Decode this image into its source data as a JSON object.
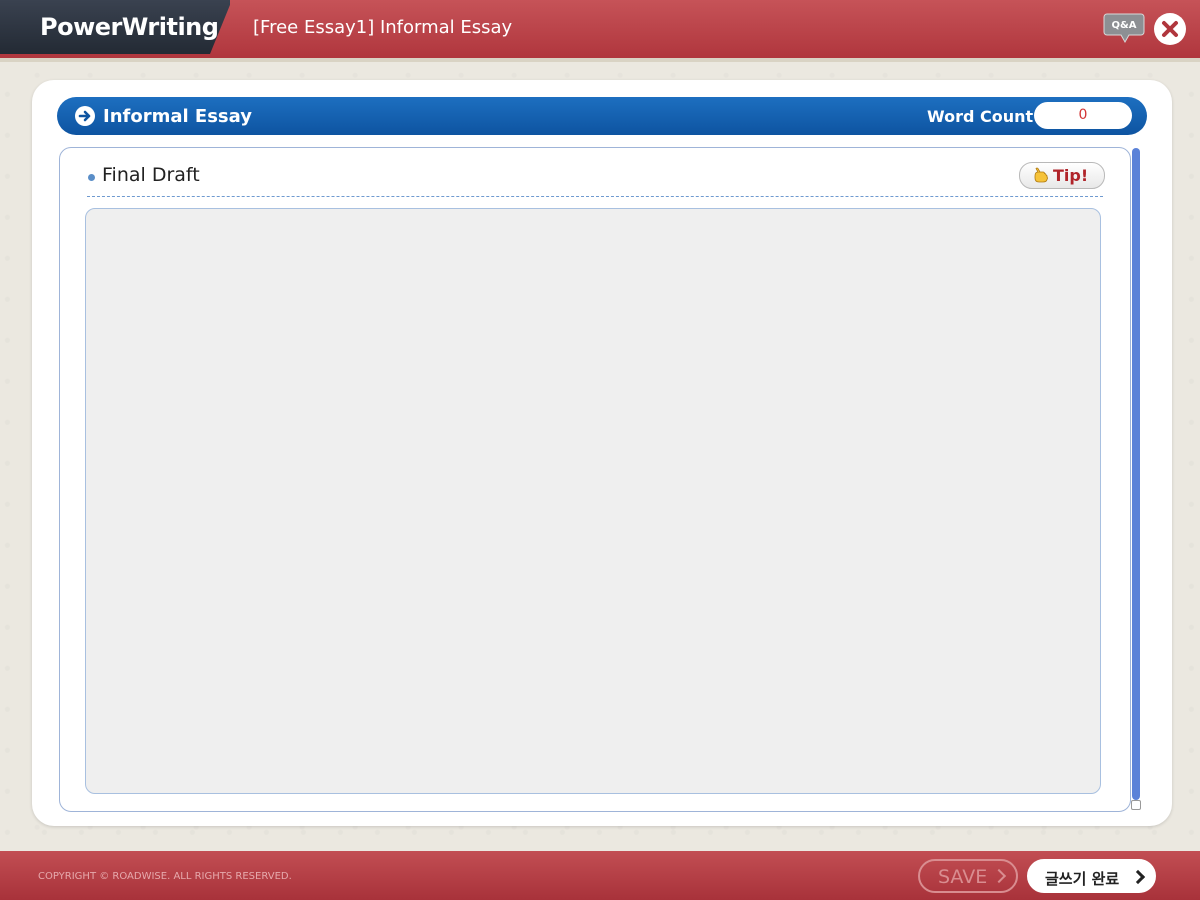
{
  "app": {
    "name": "PowerWriting",
    "page_title": "[Free Essay1] Informal Essay",
    "qa_label": "Q&A"
  },
  "section": {
    "title": "Informal Essay",
    "word_count_label": "Word Count",
    "word_count_value": "0"
  },
  "draft": {
    "title": "Final Draft",
    "tip_label": "Tip!",
    "editor_value": ""
  },
  "footer": {
    "copyright": "COPYRIGHT © ROADWISE. ALL RIGHTS RESERVED.",
    "save_label": "SAVE",
    "complete_label": "글쓰기 완료"
  },
  "colors": {
    "header_red": "#b0363d",
    "section_blue": "#0e54a1",
    "word_count_red": "#d23434",
    "scrollbar_blue": "#5b82d8"
  }
}
